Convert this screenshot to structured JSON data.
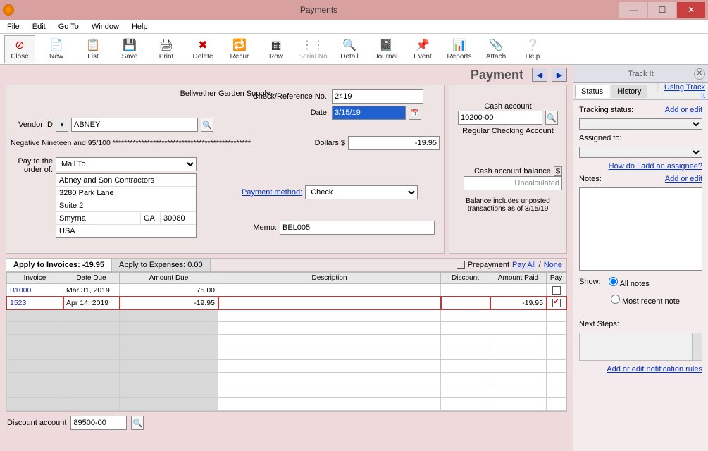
{
  "window": {
    "title": "Payments"
  },
  "menu": {
    "file": "File",
    "edit": "Edit",
    "goto": "Go To",
    "window": "Window",
    "help": "Help"
  },
  "toolbar": {
    "close": "Close",
    "new": "New",
    "list": "List",
    "save": "Save",
    "print": "Print",
    "delete": "Delete",
    "recur": "Recur",
    "row": "Row",
    "serial": "Serial No",
    "detail": "Detail",
    "journal": "Journal",
    "event": "Event",
    "reports": "Reports",
    "attach": "Attach",
    "help": "Help"
  },
  "header": {
    "title": "Payment"
  },
  "form": {
    "company": "Bellwether Garden Supply",
    "vendor_label": "Vendor ID",
    "vendor_value": "ABNEY",
    "checkref_label": "Check/Reference No.:",
    "checkref_value": "2419",
    "date_label": "Date:",
    "date_value": "3/15/19",
    "amount_words": "Negative Nineteen and 95/100 ************************************************",
    "dollars_label": "Dollars  $",
    "dollars_value": "-19.95",
    "payto_label": "Pay to the order of:",
    "payto_mailto": "Mail To",
    "addr_name": "Abney and Son Contractors",
    "addr_line1": "3280 Park Lane",
    "addr_line2": "Suite 2",
    "addr_city": "Smyrna",
    "addr_state": "GA",
    "addr_zip": "30080",
    "addr_country": "USA",
    "paymethod_label": "Payment method:",
    "paymethod_value": "Check",
    "memo_label": "Memo:",
    "memo_value": "BEL005"
  },
  "cash": {
    "account_label": "Cash account",
    "account_value": "10200-00",
    "account_name": "Regular Checking Account",
    "balance_label": "Cash account balance",
    "balance_value": "Uncalculated",
    "note": "Balance includes unposted transactions as of 3/15/19"
  },
  "grid": {
    "tab_invoices_label": "Apply to Invoices:",
    "tab_invoices_value": "-19.95",
    "tab_expenses_label": "Apply to Expenses:",
    "tab_expenses_value": "0.00",
    "prepayment": "Prepayment",
    "payall": "Pay All",
    "none": "None",
    "cols": {
      "invoice": "Invoice",
      "datedue": "Date Due",
      "amountdue": "Amount Due",
      "description": "Description",
      "discount": "Discount",
      "amountpaid": "Amount Paid",
      "pay": "Pay"
    },
    "rows": [
      {
        "invoice": "B1000",
        "datedue": "Mar 31, 2019",
        "amountdue": "75.00",
        "description": "",
        "discount": "",
        "amountpaid": "",
        "pay": false
      },
      {
        "invoice": "1523",
        "datedue": "Apr 14, 2019",
        "amountdue": "-19.95",
        "description": "",
        "discount": "",
        "amountpaid": "-19.95",
        "pay": true
      }
    ]
  },
  "discount": {
    "label": "Discount account",
    "value": "89500-00"
  },
  "trackit": {
    "title": "Track It",
    "using": "Using Track It",
    "status_tab": "Status",
    "history_tab": "History",
    "tracking_status": "Tracking status:",
    "addoredit": "Add or edit",
    "assigned_to": "Assigned to:",
    "howadd": "How do I add an assignee?",
    "notes": "Notes:",
    "show": "Show:",
    "allnotes": "All notes",
    "mostrecent": "Most recent note",
    "nextsteps": "Next Steps:",
    "rules": "Add or edit notification rules"
  }
}
